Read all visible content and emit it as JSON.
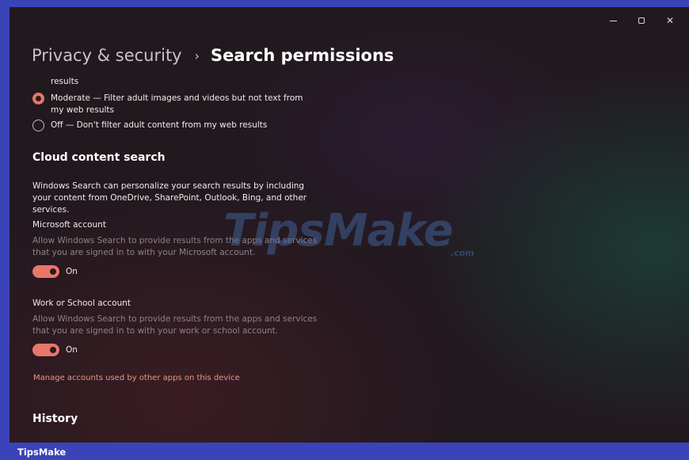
{
  "window": {
    "controls": {
      "minimize": "—",
      "restore": "",
      "close": "✕"
    }
  },
  "breadcrumb": {
    "parent": "Privacy & security",
    "separator": "›",
    "current": "Search permissions"
  },
  "safe_search": {
    "cut_text": "results",
    "options": [
      {
        "label": "Moderate — Filter adult images and videos but not text from my web results",
        "selected": true
      },
      {
        "label": "Off — Don't filter adult content from my web results",
        "selected": false
      }
    ]
  },
  "cloud": {
    "heading": "Cloud content search",
    "description": "Windows Search can personalize your search results by including your content from OneDrive, SharePoint, Outlook, Bing, and other services.",
    "microsoft": {
      "title": "Microsoft account",
      "description": "Allow Windows Search to provide results from the apps and services that you are signed in to with your Microsoft account.",
      "toggle_state": "On"
    },
    "work": {
      "title": "Work or School account",
      "description": "Allow Windows Search to provide results from the apps and services that you are signed in to with your work or school account.",
      "toggle_state": "On"
    },
    "manage_link": "Manage accounts used by other apps on this device"
  },
  "history": {
    "heading": "History"
  },
  "watermark": {
    "text": "TipsMake",
    "suffix": ".com"
  },
  "footer": {
    "brand": "TipsMake"
  },
  "colors": {
    "accent": "#e9766a",
    "frame": "#3a44b8",
    "link": "#e49a86"
  }
}
